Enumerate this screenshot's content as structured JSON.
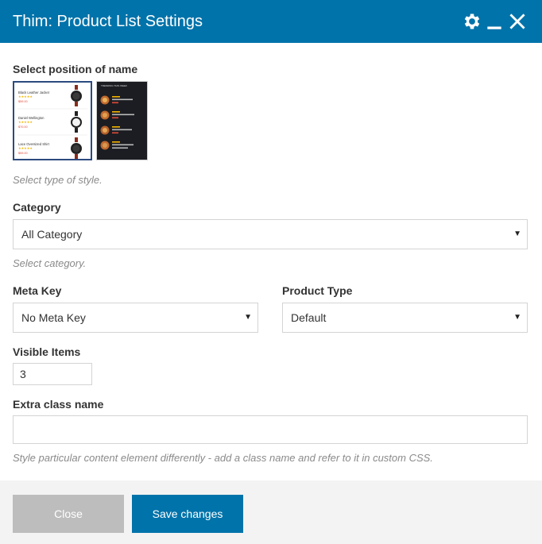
{
  "header": {
    "title": "Thim: Product List Settings",
    "icons": [
      "gear-icon",
      "minimize-icon",
      "close-icon"
    ]
  },
  "fields": {
    "position": {
      "label": "Select position of name",
      "hint": "Select type of style.",
      "options": [
        "light-list-style",
        "dark-list-style"
      ],
      "selected": "light-list-style",
      "thumb_light": {
        "items": [
          {
            "name": "Black Leather Jacket",
            "price": "$59.00"
          },
          {
            "name": "Daniel Wellington",
            "price": "$70.00"
          },
          {
            "name": "Lace Oversized Shirt",
            "price": "$59.00"
          }
        ]
      },
      "thumb_dark": {
        "heading": "TRENDING THIS WEEK"
      }
    },
    "category": {
      "label": "Category",
      "value": "All Category",
      "hint": "Select category."
    },
    "meta_key": {
      "label": "Meta Key",
      "value": "No Meta Key"
    },
    "product_type": {
      "label": "Product Type",
      "value": "Default"
    },
    "visible_items": {
      "label": "Visible Items",
      "value": "3"
    },
    "extra_class": {
      "label": "Extra class name",
      "value": "",
      "hint": "Style particular content element differently - add a class name and refer to it in custom CSS."
    }
  },
  "footer": {
    "close_label": "Close",
    "save_label": "Save changes"
  },
  "colors": {
    "header": "#0073aa",
    "save_button": "#0073aa",
    "close_button": "#bdbdbd",
    "selected_border": "#2c4a7f"
  }
}
